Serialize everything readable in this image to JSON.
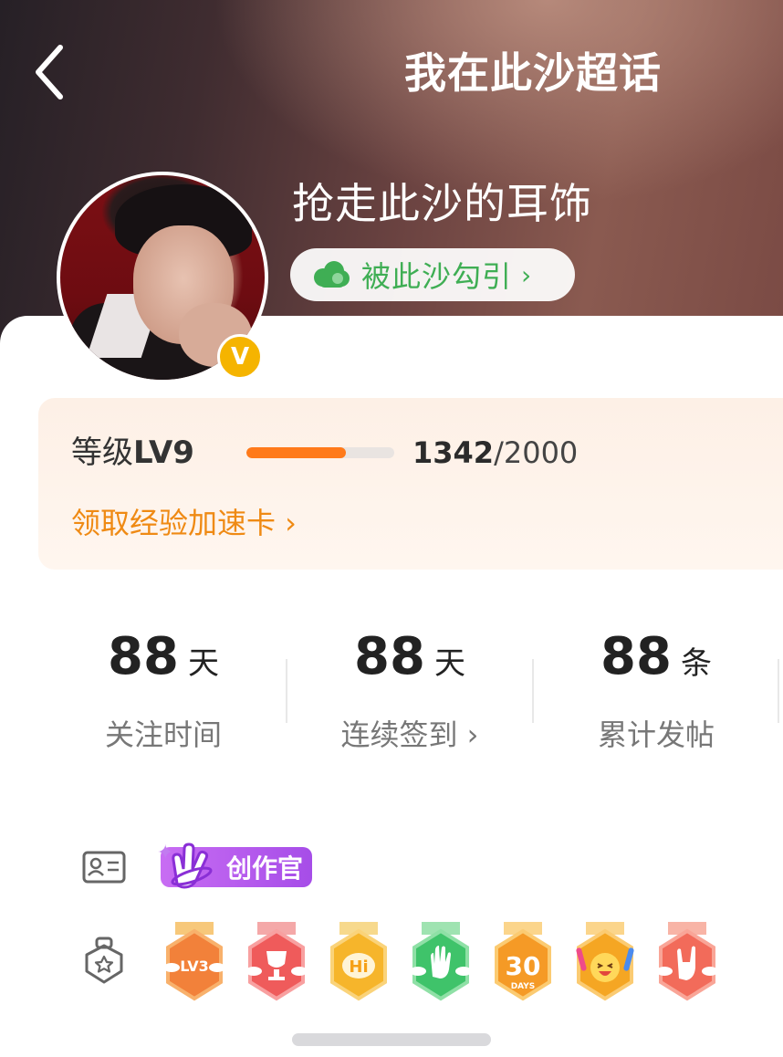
{
  "header": {
    "title": "我在此沙超话",
    "back_icon": "chevron-left-icon"
  },
  "profile": {
    "name": "抢走此沙的耳饰",
    "verified_badge": "V",
    "fan_title": "被此沙勾引",
    "fan_title_arrow": "›",
    "fan_icon": "cloud-icon"
  },
  "level": {
    "label": "等级",
    "level": "LV9",
    "current": "1342",
    "separator": "/",
    "total": "2000",
    "progress": 0.671,
    "boost_link": "领取经验加速卡 ›",
    "accent_color": "#ff7a1a"
  },
  "stats": [
    {
      "value": "88",
      "unit": "天",
      "label": "关注时间"
    },
    {
      "value": "88",
      "unit": "天",
      "label": "连续签到 ›"
    },
    {
      "value": "88",
      "unit": "条",
      "label": "累计发帖"
    }
  ],
  "badges": {
    "creator_tag": "创作官",
    "id_card_icon": "id-card-icon",
    "medal_row_icon": "star-shield-icon",
    "medals": [
      {
        "name": "lv3-medal",
        "text": "LV3",
        "color": "#f2813a"
      },
      {
        "name": "trophy-medal",
        "text": "",
        "color": "#ef5b5b"
      },
      {
        "name": "hi-medal",
        "text": "Hi",
        "color": "#f6b52b"
      },
      {
        "name": "hand-medal",
        "text": "",
        "color": "#3fc36a"
      },
      {
        "name": "30-days-medal",
        "text": "30",
        "subtext": "DAYS",
        "color": "#f59a26"
      },
      {
        "name": "cheer-medal",
        "text": "",
        "color": "#f5a623"
      },
      {
        "name": "rock-hand-medal",
        "text": "",
        "color": "#f26b5a"
      }
    ]
  }
}
